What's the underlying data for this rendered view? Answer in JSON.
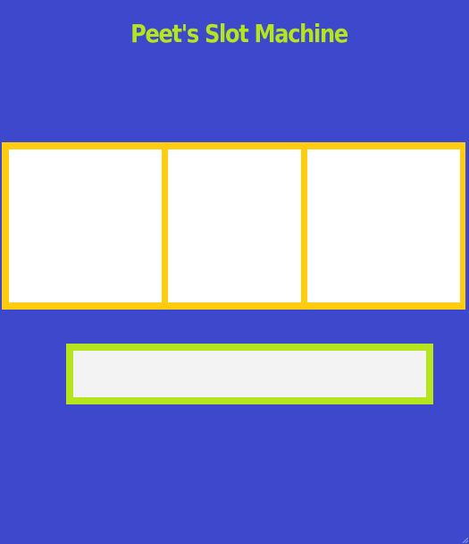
{
  "app": {
    "title": "Peet's Slot Machine"
  },
  "reels": [
    {
      "symbol": ""
    },
    {
      "symbol": ""
    },
    {
      "symbol": ""
    }
  ],
  "result": {
    "message": ""
  },
  "colors": {
    "background": "#3d48cc",
    "title": "#b5e61d",
    "reel_frame": "#ffcc0f",
    "reel_face": "#ffffff",
    "result_frame": "#b5e61d",
    "result_face": "#f3f3f3"
  }
}
